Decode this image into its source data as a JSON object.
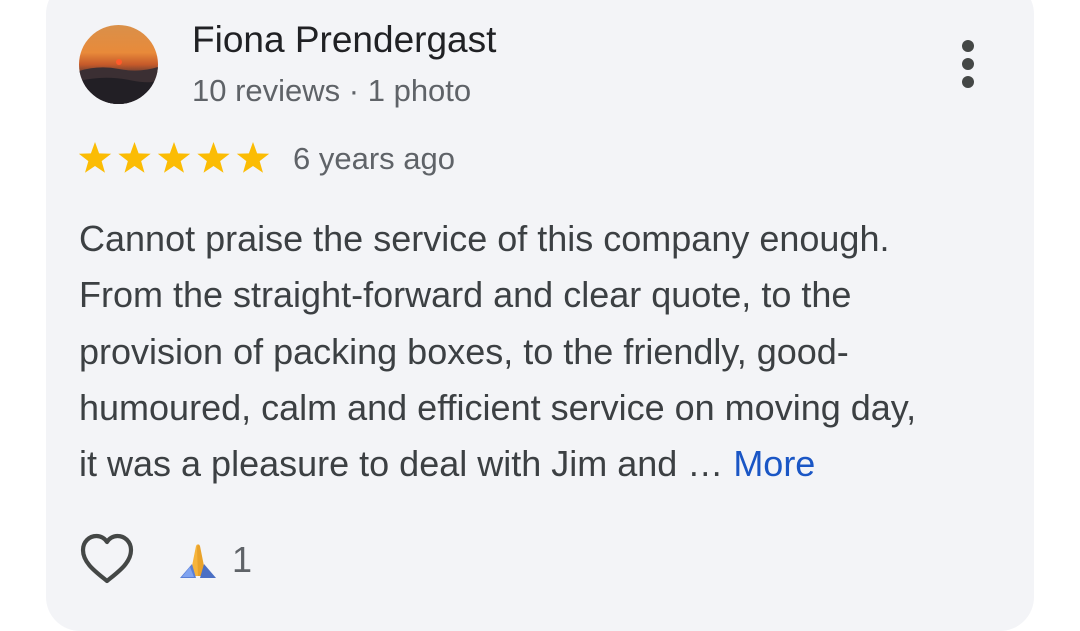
{
  "review": {
    "author_name": "Fiona Prendergast",
    "author_meta": "10 reviews · 1 photo",
    "rating": 5,
    "rating_max": 5,
    "date": "6 years ago",
    "text_lines": [
      "Cannot praise the service of this company enough.",
      "From the straight-forward and clear quote, to the",
      "provision of packing boxes, to the friendly, good-",
      "humoured, calm and efficient service on moving day,",
      "it was a pleasure to deal with Jim and … "
    ],
    "more_label": "More",
    "reaction_count": "1"
  },
  "icons": {
    "menu": "more-vert-icon",
    "like": "heart-outline-icon",
    "reaction": "folded-hands-icon",
    "star": "star-icon"
  },
  "colors": {
    "card_background": "#f3f4f7",
    "star": "#fbbc04",
    "link": "#1a56c5",
    "primary_text": "#202124",
    "secondary_text": "#5f6368"
  }
}
